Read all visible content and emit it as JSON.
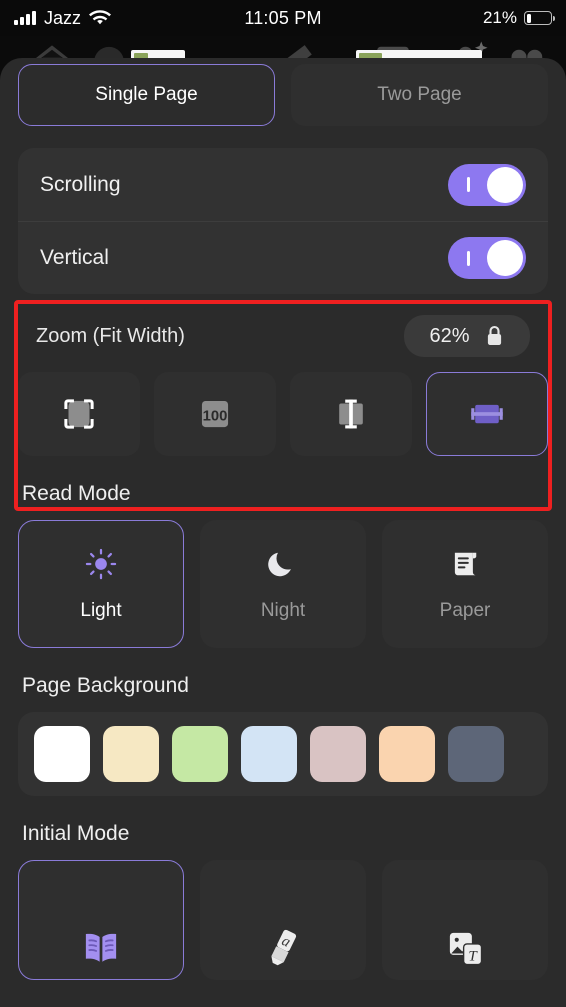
{
  "status_bar": {
    "carrier": "Jazz",
    "time": "11:05 PM",
    "battery_percent": "21%",
    "signal_icon": "signal-bars-icon",
    "wifi_icon": "wifi-icon",
    "battery_icon": "battery-icon"
  },
  "toolbar": {
    "icons": [
      {
        "name": "home-icon"
      },
      {
        "name": "mask-icon"
      },
      {
        "name": "highlighter-icon"
      },
      {
        "name": "image-icon"
      },
      {
        "name": "ai-person-icon"
      },
      {
        "name": "quote-icon"
      }
    ]
  },
  "page_layout": {
    "options": [
      {
        "label": "Single Page",
        "selected": true
      },
      {
        "label": "Two Page",
        "selected": false
      }
    ]
  },
  "toggles": [
    {
      "label": "Scrolling",
      "on": true
    },
    {
      "label": "Vertical",
      "on": true
    }
  ],
  "zoom": {
    "title": "Zoom (Fit Width)",
    "value": "62%",
    "lock_icon": "lock-icon",
    "highlighted": true,
    "modes": [
      {
        "name": "fit-page",
        "selected": false
      },
      {
        "name": "actual-size-100",
        "label": "100",
        "selected": false
      },
      {
        "name": "fit-height",
        "selected": false
      },
      {
        "name": "fit-width",
        "selected": true
      }
    ]
  },
  "read_mode": {
    "title": "Read Mode",
    "options": [
      {
        "label": "Light",
        "icon": "sun-icon",
        "selected": true
      },
      {
        "label": "Night",
        "icon": "moon-icon",
        "selected": false
      },
      {
        "label": "Paper",
        "icon": "scroll-icon",
        "selected": false
      }
    ]
  },
  "page_background": {
    "title": "Page Background",
    "swatches": [
      {
        "name": "white",
        "color": "#ffffff"
      },
      {
        "name": "cream",
        "color": "#f6e8c3"
      },
      {
        "name": "light-green",
        "color": "#c5e8a4"
      },
      {
        "name": "light-blue",
        "color": "#d3e4f5"
      },
      {
        "name": "dusty-pink",
        "color": "#d9c3c3"
      },
      {
        "name": "peach",
        "color": "#fad4af"
      },
      {
        "name": "slate",
        "color": "#5d6678"
      }
    ]
  },
  "initial_mode": {
    "title": "Initial Mode",
    "options": [
      {
        "name": "read-book",
        "icon": "open-book-icon",
        "selected": true
      },
      {
        "name": "annotate",
        "icon": "highlighter-pen-icon",
        "selected": false
      },
      {
        "name": "media-text",
        "icon": "image-text-icon",
        "selected": false
      }
    ]
  },
  "colors": {
    "accent": "#8a7bd8",
    "toggle_on": "#8d78f0",
    "highlight_box": "#ee2020",
    "sheet_bg": "#2b2b2b"
  }
}
